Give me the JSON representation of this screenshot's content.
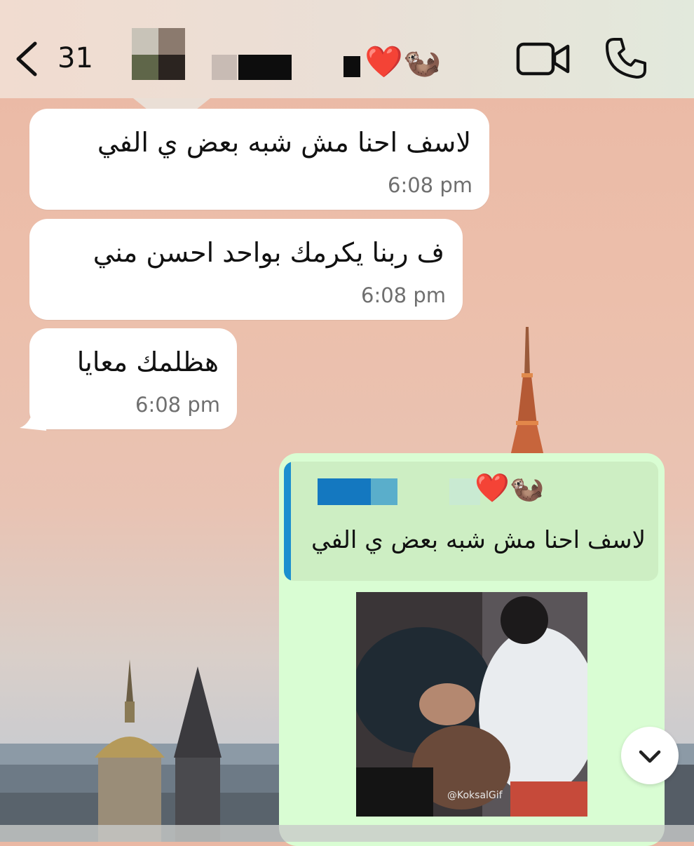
{
  "header": {
    "unread_count": "31",
    "contact_emojis": "❤️🦦",
    "back_icon": "chevron-left-icon",
    "video_icon": "video-camera-icon",
    "call_icon": "phone-icon"
  },
  "messages": [
    {
      "direction": "incoming",
      "text": "لاسف احنا مش شبه بعض ي الفي",
      "time": "6:08 pm"
    },
    {
      "direction": "incoming",
      "text": "ف ربنا يكرمك بواحد احسن مني",
      "time": "6:08 pm"
    },
    {
      "direction": "incoming",
      "text": "هظلمك معايا",
      "time": "6:08 pm"
    }
  ],
  "outgoing": {
    "quoted_emojis": "❤️🦦",
    "quoted_text": "لاسف احنا مش شبه بعض ي الفي",
    "media_watermark": "@KoksalGif"
  },
  "colors": {
    "incoming_bubble": "#ffffff",
    "outgoing_bubble": "#d9fdd3",
    "quote_bar": "#1b8fcf"
  },
  "scroll_icon": "chevron-down-icon"
}
